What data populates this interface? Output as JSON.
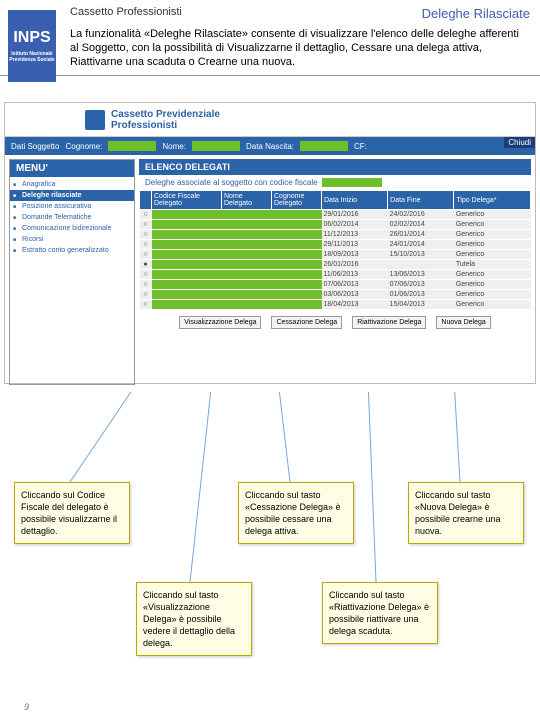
{
  "header": {
    "left": "Cassetto Professionisti",
    "right": "Deleghe Rilasciate"
  },
  "logo": {
    "main": "INPS",
    "sub": "Istituto Nazionale Previdenza Sociale"
  },
  "intro": "La funzionalità «Deleghe Rilasciate» consente di visualizzare l'elenco delle deleghe afferenti al Soggetto, con la possibilità di Visualizzarne il dettaglio, Cessare una delega attiva, Riattivarne una scaduta o Crearne una nuova.",
  "app": {
    "title1": "Cassetto Previdenziale",
    "title2": "Professionisti",
    "chiudi": "Chiudi",
    "databar": {
      "l1": "Dati Soggetto",
      "l2": "Cognome:",
      "l3": "Nome:",
      "l4": "Data Nascita:",
      "l5": "CF:"
    },
    "menu_hd": "MENU'",
    "menu": [
      "Anagrafica",
      "Deleghe rilasciate",
      "Posizione assicurativa",
      "Domande Telematiche",
      "Comunicazione bidirezionale",
      "Ricorsi",
      "Estratto conto generalizzato"
    ],
    "elenco_hd": "ELENCO DELEGATI",
    "sub": "Deleghe associate al soggetto con codice fiscale",
    "cols": [
      "",
      "Codice Fiscale Delegato",
      "Nome Delegato",
      "Cognome Delegato",
      "Data Inizio",
      "Data Fine",
      "Tipo Delega*"
    ],
    "rows": [
      {
        "di": "29/01/2016",
        "df": "24/02/2016",
        "tp": "Generico"
      },
      {
        "di": "06/02/2014",
        "df": "02/02/2014",
        "tp": "Generico"
      },
      {
        "di": "11/12/2013",
        "df": "26/01/2014",
        "tp": "Generico"
      },
      {
        "di": "29/11/2013",
        "df": "24/01/2014",
        "tp": "Generico"
      },
      {
        "di": "18/09/2013",
        "df": "15/10/2013",
        "tp": "Generico"
      },
      {
        "di": "26/01/2016",
        "df": "",
        "tp": "Tutela"
      },
      {
        "di": "11/06/2013",
        "df": "13/06/2013",
        "tp": "Generico"
      },
      {
        "di": "07/06/2013",
        "df": "07/06/2013",
        "tp": "Generico"
      },
      {
        "di": "03/06/2013",
        "df": "01/06/2013",
        "tp": "Generico"
      },
      {
        "di": "18/04/2013",
        "df": "15/04/2013",
        "tp": "Generico"
      }
    ],
    "buttons": [
      "Visualizzazione Delega",
      "Cessazione Delega",
      "Riattivazione Delega",
      "Nuova Delega"
    ]
  },
  "callouts": {
    "b1": "Cliccando sul Codice Fiscale del delegato è possibile visualizzarne il dettaglio.",
    "b2": "Cliccando sul tasto «Cessazione Delega» è possibile cessare una delega attiva.",
    "b3": "Cliccando sul tasto «Nuova Delega» è possibile crearne una nuova.",
    "b4": "Cliccando sul tasto «Visualizzazione Delega» è possibile vedere il dettaglio della delega.",
    "b5": "Cliccando sul tasto «Riattivazione Delega» è possibile riattivare una delega scaduta."
  },
  "pagenum": "9"
}
